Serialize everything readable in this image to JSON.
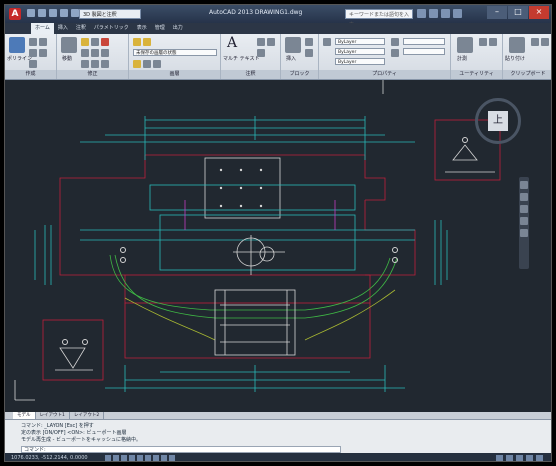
{
  "titlebar": {
    "logo": "A",
    "workspace": "3D 製図と注釈",
    "title": "AutoCAD 2013   DRAWING1.dwg",
    "search_placeholder": "キーワードまたは語句を入力"
  },
  "tabs": [
    "ホーム",
    "挿入",
    "注釈",
    "パラメトリック",
    "表示",
    "管理",
    "出力"
  ],
  "ribbon": {
    "panels": {
      "draw": "作成",
      "modify": "修正",
      "layers": "画層",
      "annotation": "注釈",
      "block": "ブロック",
      "properties": "プロパティ",
      "utilities": "ユーティリティ",
      "clipboard": "クリップボード"
    },
    "polyline_label": "ポリライン",
    "move_label": "移動",
    "layer_combo": "未保存の画層の状態",
    "text_label": "マルチ テキスト",
    "insert_label": "挿入",
    "bylayer1": "ByLayer",
    "bylayer2": "ByLayer",
    "bylayer3": "ByLayer",
    "measure_label": "計測",
    "paste_label": "貼り付け"
  },
  "viewcube": {
    "face": "上"
  },
  "layout_tabs": [
    "モデル",
    "レイアウト1",
    "レイアウト2"
  ],
  "command": {
    "lines": [
      "コマンド: _LAYON  [Esc] を押す",
      "定の表示 [ON/OFF] <ON>: ビューポート画層",
      "モデル再生成 - ビューポートをキャッシュに格納中。"
    ],
    "prompt": "コマンド:"
  },
  "status": {
    "coords": "1076.0233, -512.2144, 0.0000"
  }
}
